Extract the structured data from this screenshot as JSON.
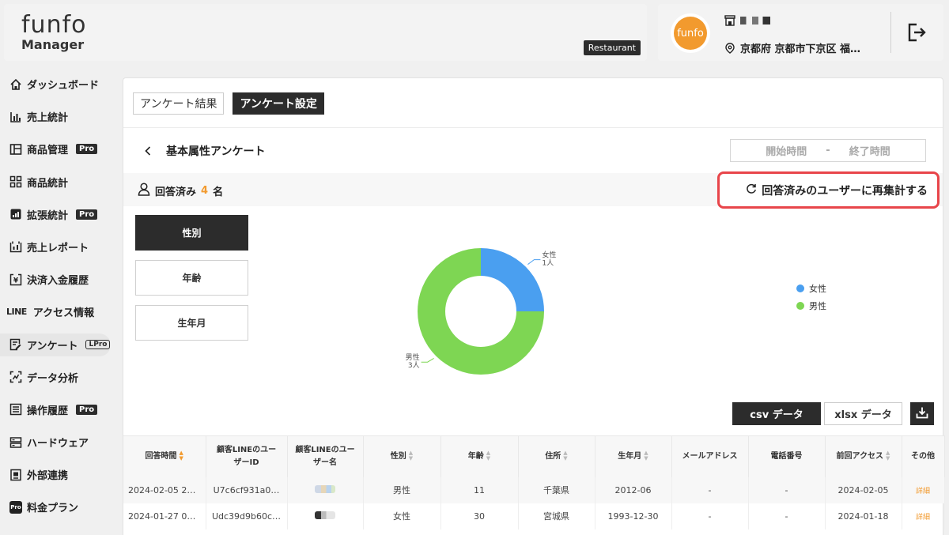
{
  "header": {
    "logo_line1": "funfo",
    "logo_line2": "Manager",
    "store_type": "Restaurant",
    "store_avatar_text": "funfo",
    "store_address": "京都府 京都市下京区 福…"
  },
  "sidebar": {
    "items": [
      {
        "label": "ダッシュボード",
        "icon": "home-icon"
      },
      {
        "label": "売上統計",
        "icon": "bar-chart-icon"
      },
      {
        "label": "商品管理",
        "icon": "product-manage-icon",
        "badge": "Pro"
      },
      {
        "label": "商品統計",
        "icon": "grid-icon"
      },
      {
        "label": "拡張統計",
        "icon": "extended-stats-icon",
        "badge": "Pro"
      },
      {
        "label": "売上レポート",
        "icon": "report-icon"
      },
      {
        "label": "決済入金履歴",
        "icon": "payment-history-icon"
      },
      {
        "label": "アクセス情報",
        "prefix": "LINE"
      },
      {
        "label": "アンケート",
        "icon": "survey-icon",
        "badge": "LPro"
      },
      {
        "label": "データ分析",
        "icon": "data-analysis-icon"
      },
      {
        "label": "操作履歴",
        "icon": "list-icon",
        "badge": "Pro"
      },
      {
        "label": "ハードウェア",
        "icon": "hardware-icon"
      },
      {
        "label": "外部連携",
        "icon": "integration-icon"
      },
      {
        "label": "料金プラン",
        "icon": "pro-plan-icon",
        "icon_text": "Pro"
      }
    ]
  },
  "main": {
    "tabs": [
      {
        "label": "アンケート結果"
      },
      {
        "label": "アンケート設定"
      }
    ],
    "title": "基本属性アンケート",
    "date_start_placeholder": "開始時間",
    "date_sep": "-",
    "date_end_placeholder": "終了時間",
    "answered_prefix": "回答済み",
    "answered_count": "4",
    "answered_suffix": "名",
    "recalc_label": "回答済みのユーザーに再集計する",
    "questions": [
      {
        "label": "性別"
      },
      {
        "label": "年齢"
      },
      {
        "label": "生年月"
      }
    ],
    "export_csv": "csv データ",
    "export_xlsx": "xlsx データ"
  },
  "colors": {
    "accent": "#f29a2e",
    "female": "#4a9ff0",
    "male": "#7ed653",
    "highlight": "#e8454a",
    "dark": "#2c2c2c"
  },
  "chart_data": {
    "type": "pie",
    "donut": true,
    "categories": [
      "女性",
      "男性"
    ],
    "values": [
      1,
      3
    ],
    "labels": [
      {
        "name": "女性",
        "value_text": "1人"
      },
      {
        "name": "男性",
        "value_text": "3人"
      }
    ],
    "legend": [
      "女性",
      "男性"
    ],
    "legend_position": "right"
  },
  "table": {
    "columns": [
      "回答時間",
      "顧客LINEのユーザーID",
      "顧客LINEのユーザー名",
      "性別",
      "年齢",
      "住所",
      "生年月",
      "メールアドレス",
      "電話番号",
      "前回アクセス",
      "その他"
    ],
    "column_lines": [
      [
        "回答時間"
      ],
      [
        "顧客LINEのユー",
        "ザーID"
      ],
      [
        "顧客LINEのユー",
        "ザー名"
      ],
      [
        "性別"
      ],
      [
        "年齢"
      ],
      [
        "住所"
      ],
      [
        "生年月"
      ],
      [
        "メールアドレス"
      ],
      [
        "電話番号"
      ],
      [
        "前回アクセス"
      ],
      [
        "その他"
      ]
    ],
    "rows": [
      [
        "2024-02-05 22…",
        "U7c6cf931a0…",
        "",
        "男性",
        "11",
        "千葉県",
        "2012-06",
        "-",
        "-",
        "2024-02-05",
        "詳細"
      ],
      [
        "2024-01-27 00…",
        "Udc39d9b60c…",
        "",
        "女性",
        "30",
        "宮城県",
        "1993-12-30",
        "-",
        "-",
        "2024-01-18",
        "詳細"
      ]
    ]
  }
}
